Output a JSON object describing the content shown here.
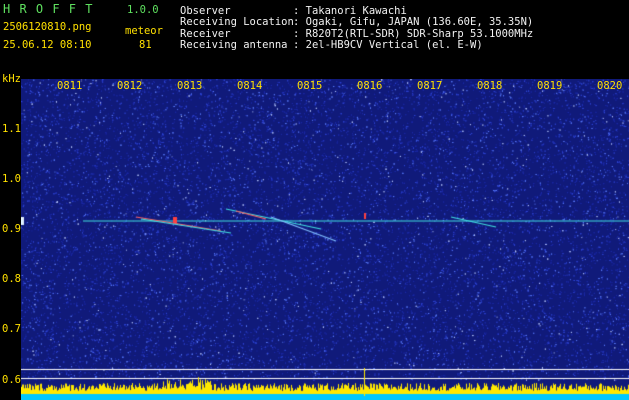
{
  "header": {
    "app_name": "H R O F F T",
    "version": "1.0.0",
    "filename": "2506120810.png",
    "meteor_label": "meteor",
    "datetime": "25.06.12 08:10",
    "meteor_count": "81",
    "info": [
      {
        "key": "Observer",
        "value": ": Takanori Kawachi"
      },
      {
        "key": "Receiving Location",
        "value": ": Ogaki, Gifu, JAPAN (136.60E, 35.35N)"
      },
      {
        "key": "Receiver",
        "value": ": R820T2(RTL-SDR) SDR-Sharp 53.1000MHz"
      },
      {
        "key": "Receiving antenna",
        "value": ": 2el-HB9CV Vertical (el. E-W)"
      }
    ]
  },
  "axes": {
    "y_unit": "kHz",
    "y_ticks": [
      "1.1",
      "1.0",
      "0.9",
      "0.8",
      "0.7",
      "0.6"
    ],
    "x_ticks": [
      "0811",
      "0812",
      "0813",
      "0814",
      "0815",
      "0816",
      "0817",
      "0818",
      "0819",
      "0820"
    ]
  },
  "colors": {
    "background_noise": "#101a7a",
    "header_green": "#5fe05f",
    "header_yellow": "#ffe000",
    "trace": "#40e0e0",
    "activity_bar": "#ffe800",
    "activity_base": "#00c8ff"
  }
}
